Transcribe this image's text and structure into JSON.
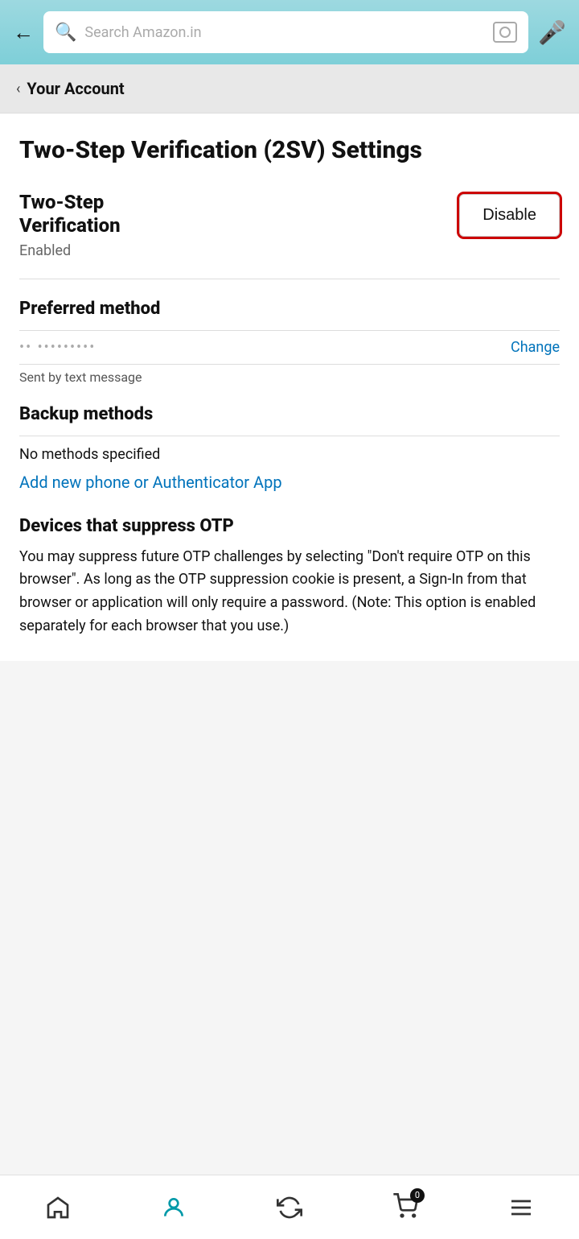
{
  "header": {
    "back_label": "←",
    "search_placeholder": "Search Amazon.in",
    "mic_icon": "microphone-icon",
    "camera_icon": "camera-icon"
  },
  "breadcrumb": {
    "arrow": "‹",
    "text": "Your Account"
  },
  "page": {
    "title": "Two-Step Verification (2SV) Settings"
  },
  "two_step_verification": {
    "label_line1": "Two-Step",
    "label_line2": "Verification",
    "status": "Enabled",
    "disable_button": "Disable"
  },
  "preferred_method": {
    "section_title": "Preferred method",
    "phone_blurred": "•• •••••••••",
    "change_link": "Change",
    "sent_by": "Sent by text message"
  },
  "backup_methods": {
    "section_title": "Backup methods",
    "no_methods": "No methods specified",
    "add_link": "Add new phone or Authenticator App"
  },
  "otp_section": {
    "title": "Devices that suppress OTP",
    "description": "You may suppress future OTP challenges by selecting \"Don't require OTP on this browser\". As long as the OTP suppression cookie is present, a Sign-In from that browser or application will only require a password. (Note: This option is enabled separately for each browser that you use.)"
  },
  "bottom_nav": {
    "home_label": "Home",
    "account_label": "Account",
    "returns_label": "Returns",
    "cart_label": "Cart",
    "cart_count": "0",
    "menu_label": "Menu"
  }
}
